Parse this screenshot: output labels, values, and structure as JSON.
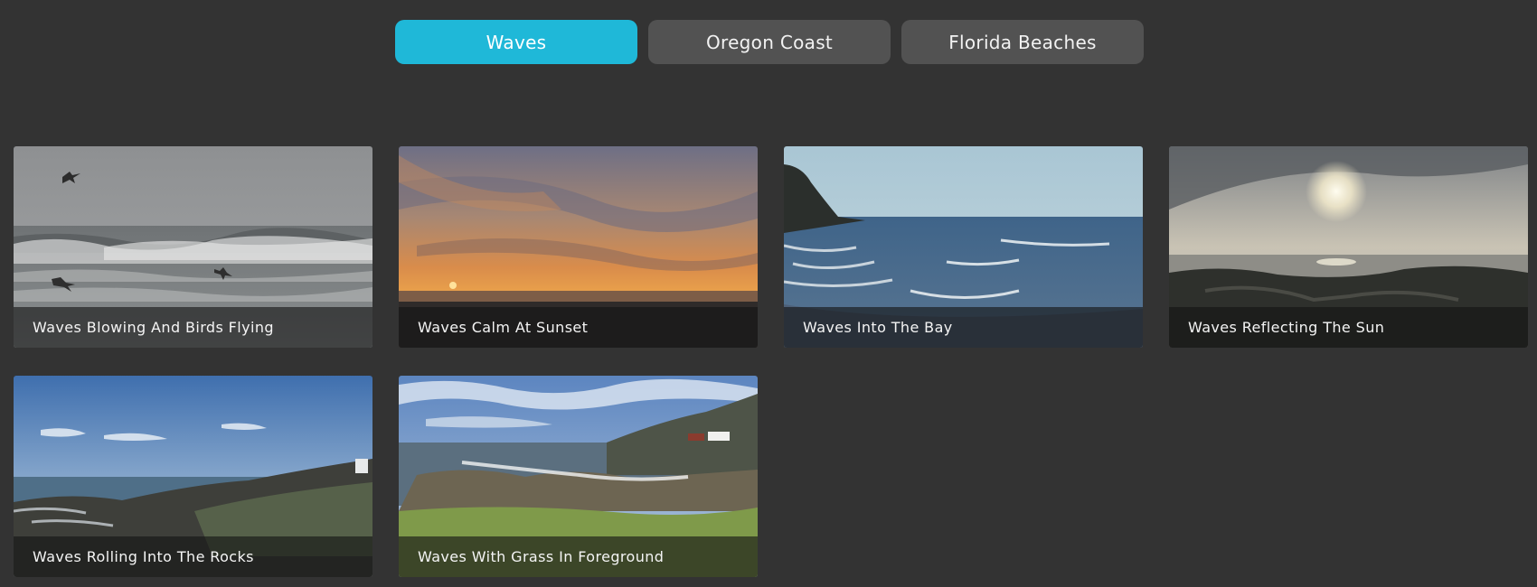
{
  "tabs": [
    {
      "label": "Waves",
      "active": true
    },
    {
      "label": "Oregon Coast",
      "active": false
    },
    {
      "label": "Florida Beaches",
      "active": false
    }
  ],
  "videos": [
    {
      "title": "Waves Blowing And Birds Flying"
    },
    {
      "title": "Waves Calm At Sunset"
    },
    {
      "title": "Waves Into The Bay"
    },
    {
      "title": "Waves Reflecting The Sun"
    },
    {
      "title": "Waves Rolling Into The Rocks"
    },
    {
      "title": "Waves With Grass In Foreground"
    }
  ],
  "colors": {
    "background": "#333333",
    "active_tab": "#1fb8d8",
    "inactive_tab": "#525252"
  }
}
